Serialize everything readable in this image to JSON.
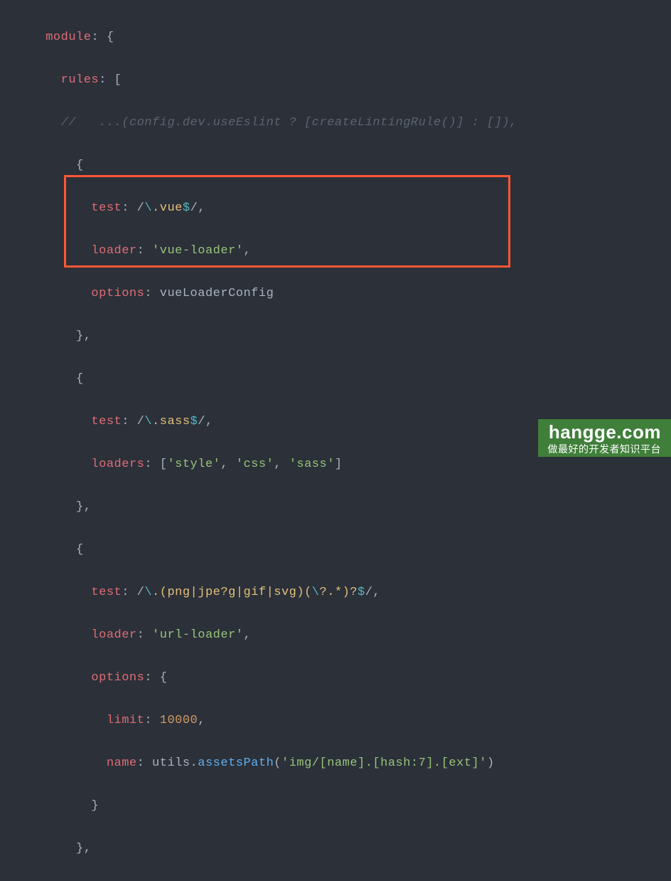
{
  "indent": {
    "i3": "      ",
    "i4": "        ",
    "i5": "          ",
    "i6": "            "
  },
  "text": {
    "module": "module",
    "rules": "rules",
    "test": "test",
    "loader": "loader",
    "loaders": "loaders",
    "options": "options",
    "limit": "limit",
    "name": "name",
    "colon": ":",
    "space": " ",
    "lbrace": "{",
    "rbrace": "}",
    "lbrack": "[",
    "rbrack": "]",
    "comma": ",",
    "braceComma": "},",
    "slash": "/",
    "vueLoader": "'vue-loader'",
    "vueLoaderConfig": "vueLoaderConfig",
    "style": "'style'",
    "css": "'css'",
    "sass": "'sass'",
    "urlLoader": "'url-loader'",
    "tenThousand": "10000",
    "utilsDot": "utils.",
    "assetsPath": "assetsPath",
    "lparen": "(",
    "rparen": ")",
    "imgPath": "'img/[name].[hash:7].[ext]'",
    "commentLine": "//   ...(config.dev.useEslint ? [createLintingRule()] : []),",
    "regex_vue_body_a": "\\",
    "regex_vue_body_b": ".vue",
    "regex_vue_body_c": "$",
    "regex_sass_body_a": "\\",
    "regex_sass_body_b": ".sass",
    "regex_sass_body_c": "$",
    "regex_img_body_a": "\\",
    "regex_img_body_b": ".(png|jpe?g|gif|svg)(",
    "regex_img_body_c": "\\",
    "regex_img_body_d": "?.*)?",
    "regex_img_body_e": "$"
  },
  "watermark": {
    "site": "hangge.com",
    "tag": "做最好的开发者知识平台"
  }
}
